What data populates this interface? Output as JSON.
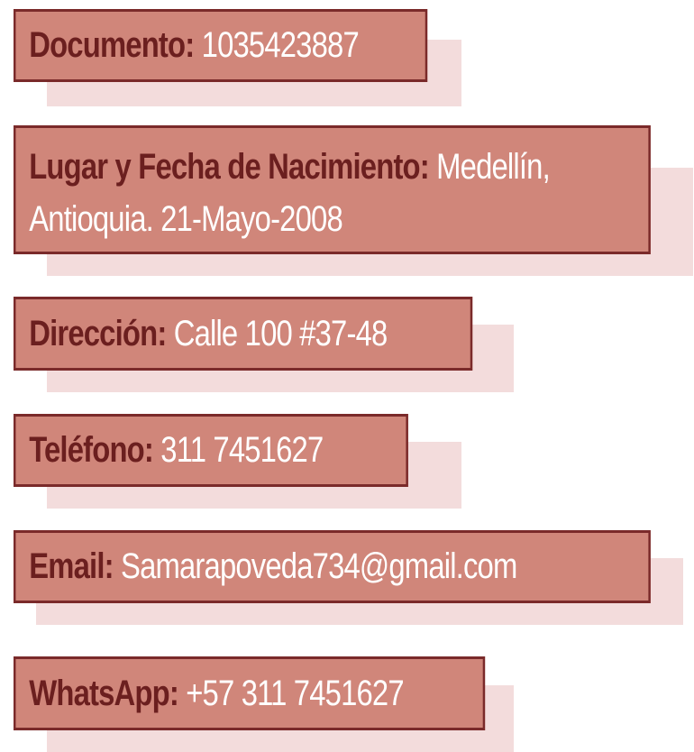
{
  "fields": {
    "documento": {
      "label": "Documento:",
      "value": " 1035423887"
    },
    "nacimiento": {
      "label": "Lugar y Fecha de Nacimiento:",
      "value": " Medellín, Antioquia. 21-Mayo-2008"
    },
    "direccion": {
      "label": "Dirección:",
      "value": " Calle 100 #37-48"
    },
    "telefono": {
      "label": "Teléfono:",
      "value": "  311 7451627"
    },
    "email": {
      "label": "Email:",
      "value": " Samarapoveda734@gmail.com"
    },
    "whatsapp": {
      "label": "WhatsApp:",
      "value": " +57 311  7451627"
    }
  },
  "colors": {
    "card_fill": "#d0867a",
    "card_border": "#7a2a2a",
    "label_text": "#6b1f1f",
    "value_text": "#ffffff",
    "shadow": "#f3dcdc"
  }
}
